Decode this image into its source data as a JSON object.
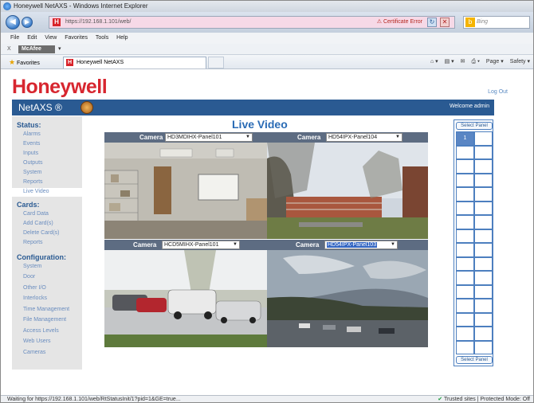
{
  "window": {
    "title": "Honeywell NetAXS - Windows Internet Explorer",
    "url": "https://192.168.1.101/web/",
    "cert_error": "Certificate Error",
    "search_placeholder": "Bing",
    "search_logo": "b"
  },
  "menu": [
    "File",
    "Edit",
    "View",
    "Favorites",
    "Tools",
    "Help"
  ],
  "addons": {
    "close": "X",
    "mcafee": "McAfee",
    "dropdown": "▾"
  },
  "favbar": {
    "favorites_label": "Favorites",
    "tab_title": "Honeywell NetAXS",
    "tools": [
      "Page ▾",
      "Safety ▾"
    ]
  },
  "header": {
    "logo": "Honeywell",
    "logout": "Log Out",
    "brand": "NetAXS ®",
    "welcome": "Welcome admin"
  },
  "sidebar": {
    "status_heading": "Status:",
    "status_items": [
      "Alarms",
      "Events",
      "Inputs",
      "Outputs",
      "System",
      "Reports",
      "Live Video"
    ],
    "cards_heading": "Cards:",
    "cards_items": [
      "Card Data",
      "Add Card(s)",
      "Delete Card(s)",
      "Reports"
    ],
    "config_heading": "Configuration:",
    "config_items": [
      "System",
      "Door",
      "Other I/O",
      "Interlocks",
      "Time Management",
      "File Management",
      "Access Levels",
      "Web Users",
      "Cameras"
    ]
  },
  "main": {
    "title": "Live Video",
    "camera_label": "Camera",
    "cameras": [
      {
        "selected": "HD3MDIHX-Panel101"
      },
      {
        "selected": "HD54IPX-Panel104"
      },
      {
        "selected": "HCD5MIHX-Panel101"
      },
      {
        "selected": "HD54IPX-Panel103"
      }
    ]
  },
  "panel": {
    "select_top": "Select Panel",
    "select_bottom": "Select Panel",
    "selected_number": "1"
  },
  "status": {
    "left": "Waiting for https://192.168.1.101/web/RtStatusInit/1?pid=1&GE=true...",
    "right": "Trusted sites | Protected Mode: Off"
  },
  "colors": {
    "brand_red": "#d7262f",
    "nav_blue": "#2a5a92",
    "link_blue": "#6a8dbf"
  }
}
